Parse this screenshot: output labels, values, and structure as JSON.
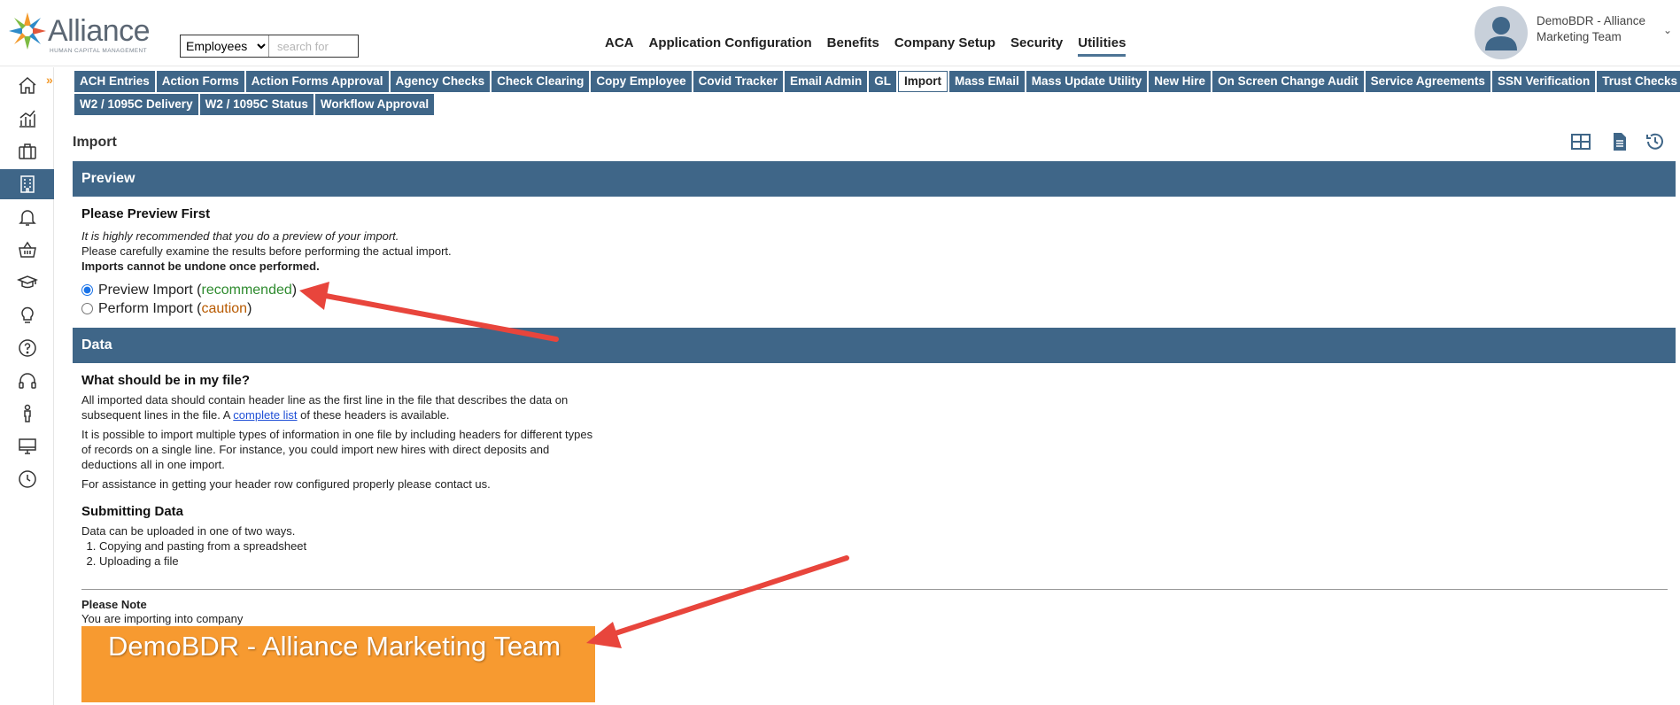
{
  "brand": {
    "name": "Alliance",
    "tagline": "HUMAN CAPITAL MANAGEMENT"
  },
  "search": {
    "scope": "Employees",
    "placeholder": "search for"
  },
  "topnav": [
    {
      "label": "ACA",
      "active": false
    },
    {
      "label": "Application Configuration",
      "active": false
    },
    {
      "label": "Benefits",
      "active": false
    },
    {
      "label": "Company Setup",
      "active": false
    },
    {
      "label": "Security",
      "active": false
    },
    {
      "label": "Utilities",
      "active": true
    }
  ],
  "user": {
    "name": "DemoBDR - Alliance Marketing Team",
    "caret": "⌄"
  },
  "rail": {
    "toggle": "»",
    "items": [
      "home-icon",
      "analytics-icon",
      "briefcase-icon",
      "building-icon",
      "bell-icon",
      "basket-icon",
      "graduation-cap-icon",
      "lightbulb-icon",
      "help-icon",
      "headset-icon",
      "person-icon",
      "monitor-icon",
      "clock-icon"
    ],
    "active_index": 3
  },
  "tabs": {
    "row1": [
      "ACH Entries",
      "Action Forms",
      "Action Forms Approval",
      "Agency Checks",
      "Check Clearing",
      "Copy Employee",
      "Covid Tracker",
      "Email Admin",
      "GL",
      "Import",
      "Mass EMail",
      "Mass Update Utility",
      "New Hire",
      "On Screen Change Audit",
      "Service Agreements",
      "SSN Verification",
      "Trust Checks"
    ],
    "row2": [
      "W2 / 1095C Delivery",
      "W2 / 1095C Status",
      "Workflow Approval"
    ],
    "active": "Import"
  },
  "page": {
    "title": "Import",
    "tools": [
      "grid-icon",
      "document-icon",
      "history-icon"
    ]
  },
  "preview": {
    "header": "Preview",
    "heading": "Please Preview First",
    "line1": "It is highly recommended that you do a preview of your import.",
    "line2": "Please carefully examine the results before performing the actual import.",
    "line3": "Imports cannot be undone once performed.",
    "option1_label": "Preview Import",
    "option1_note": "recommended",
    "option2_label": "Perform Import",
    "option2_note": "caution",
    "paren_open": "(",
    "paren_close": ")"
  },
  "data": {
    "header": "Data",
    "heading": "What should be in my file?",
    "p1_a": "All imported data should contain header line as the first line in the file that describes the data on subsequent lines in the file. A ",
    "p1_link": "complete list",
    "p1_b": " of these headers is available.",
    "p2": "It is possible to import multiple types of information in one file by including headers for different types of records on a single line. For instance, you could import new hires with direct deposits and deductions all in one import.",
    "p3": "For assistance in getting your header row configured properly please contact us.",
    "submit_heading": "Submitting Data",
    "submit_intro": "Data can be uploaded in one of two ways.",
    "steps": [
      "Copying and pasting from a spreadsheet",
      "Uploading a file"
    ],
    "note_heading": "Please Note",
    "note_text": "You are importing into company",
    "company": "DemoBDR - Alliance Marketing Team"
  },
  "colors": {
    "nav_blue": "#3f6688",
    "accent_orange": "#f79a30",
    "annotation_red": "#e8453c"
  }
}
